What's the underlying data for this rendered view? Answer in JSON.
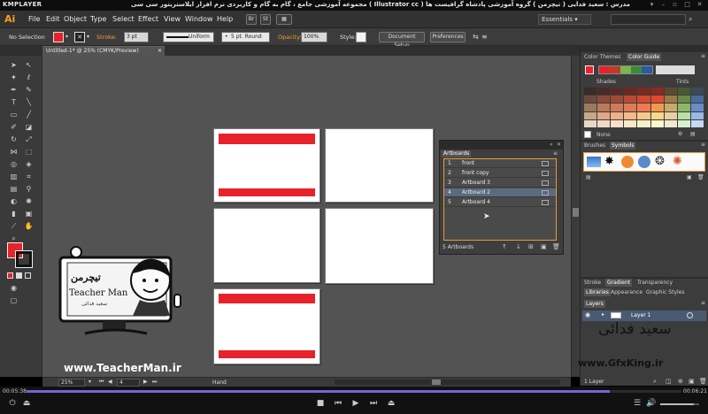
{
  "player": {
    "logo": "KMPLAYER",
    "title": "مجموعه آموزشی جامع ، گام به گام و کاربردی نرم افزار ایلاستریتور سی سی ( Illustrator cc )   مدرس : سعید فدایی ( تیچرمن ) گروه آموزشی پادشاه گرافیست ها",
    "time_elapsed": "00:05:38",
    "time_total": "00:06:21",
    "progress": 0.89
  },
  "menubar": {
    "app_logo": "Ai",
    "items": [
      "File",
      "Edit",
      "Object",
      "Type",
      "Select",
      "Effect",
      "View",
      "Window",
      "Help"
    ],
    "bridge_btn": "Br",
    "stock_btn": "St",
    "workspace": "Essentials"
  },
  "control": {
    "selection": "No Selection",
    "stroke_label": "Stroke:",
    "stroke_weight": "3 pt",
    "profile": "Uniform",
    "brush": "5 pt. Round",
    "opacity_label": "Opacity:",
    "opacity": "100%",
    "style_label": "Style:",
    "doc_setup": "Document Setup",
    "preferences": "Preferences"
  },
  "document": {
    "tab": "Untitled-1* @ 25% (CMYK/Preview)"
  },
  "artboards_panel": {
    "title": "Artboards",
    "rows": [
      {
        "num": "1",
        "name": "front"
      },
      {
        "num": "2",
        "name": "front copy"
      },
      {
        "num": "3",
        "name": "Artboard 3"
      },
      {
        "num": "4",
        "name": "Artboard 2"
      },
      {
        "num": "5",
        "name": "Artboard 4"
      }
    ],
    "selected_index": 3,
    "count": "5 Artboards"
  },
  "color_panel": {
    "tab_themes": "Color Themes",
    "tab_guide": "Color Guide",
    "shades": "Shades",
    "tints": "Tints",
    "none": "None",
    "fill_color": "#e8222a",
    "palette_rows": [
      [
        "#3a2a2a",
        "#4a2a28",
        "#5a2a26",
        "#6a2a24",
        "#7a2a22",
        "#8a2a20",
        "#5a4a30",
        "#4a5a30",
        "#3a4a5a"
      ],
      [
        "#6a4a3a",
        "#8a4a38",
        "#a04a36",
        "#b84a34",
        "#d04a32",
        "#e04a30",
        "#9a7a48",
        "#6a8a48",
        "#4a6a9a"
      ],
      [
        "#9a7a5a",
        "#b87a58",
        "#d07a56",
        "#e07a54",
        "#f07a52",
        "#f09a50",
        "#c8aa68",
        "#8ab868",
        "#6a8ac8"
      ],
      [
        "#c8a888",
        "#e0a888",
        "#f0b088",
        "#f8b888",
        "#f8c888",
        "#f8d888",
        "#e8d0a0",
        "#b8e0a0",
        "#98b8e8"
      ],
      [
        "#e8d8c8",
        "#f0d8c8",
        "#f8e0c8",
        "#f8e8c8",
        "#f8f0c8",
        "#f8f8c8",
        "#f0e8d0",
        "#d8f0d0",
        "#c8d8f0"
      ]
    ]
  },
  "brushes_panel": {
    "tab_brushes": "Brushes",
    "tab_symbols": "Symbols"
  },
  "stroke_panel": {
    "tab_stroke": "Stroke",
    "tab_gradient": "Gradient",
    "tab_transparency": "Transparency"
  },
  "libraries_panel": {
    "tab_libraries": "Libraries",
    "tab_appearance": "Appearance",
    "tab_graphic_styles": "Graphic Styles"
  },
  "layers_panel": {
    "title": "Layers",
    "layer_name": "Layer 1",
    "count": "1 Layer"
  },
  "status": {
    "zoom": "25%",
    "artboard": "4",
    "tool": "Hand"
  },
  "watermark": {
    "brand_top": "تیچرمن",
    "brand_sub": "Teacher Man",
    "brand_tagline": "سعید فدائی",
    "url_left": "www.TeacherMan.ir",
    "url_right": "www.GfxKing.ir",
    "author_script": "سعید فدائی"
  }
}
